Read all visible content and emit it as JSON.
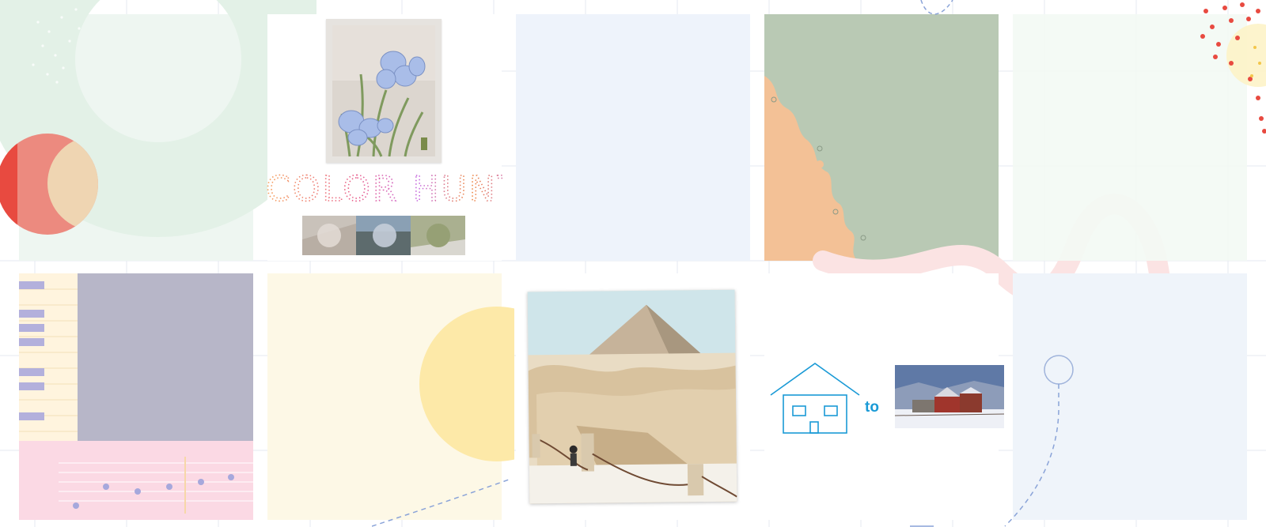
{
  "page": {
    "background": "#ffffff",
    "grid_color": "#e6eaf0"
  },
  "title": {
    "text": "COLOR HUNT",
    "colors": [
      "#f5a05a",
      "#e85d8a",
      "#c66be0",
      "#f07a50"
    ]
  },
  "labels": {
    "to": "to"
  },
  "colors": {
    "mint": "#e8f3ec",
    "mint_light": "#f1f8f3",
    "pale_blue": "#edf3fb",
    "sage": "#b9c9b4",
    "orange_land": "#f5c392",
    "pale_yellow": "#fdf8e4",
    "yellow_circle": "#fde8a6",
    "lavender_grey": "#b7b6c8",
    "pink": "#fbd9e4",
    "piano_key": "#b3b0dc",
    "red": "#e84a40",
    "salmon": "#ec8a7f",
    "house_blue": "#1a9ad6",
    "dash_blue": "#8aa3d8",
    "sky_blue_dot": "#9fb3db"
  },
  "icons": {
    "house": "house-icon",
    "iris": "iris-flower-icon",
    "pyramid": "pyramid-icon",
    "barn": "barn-icon"
  }
}
